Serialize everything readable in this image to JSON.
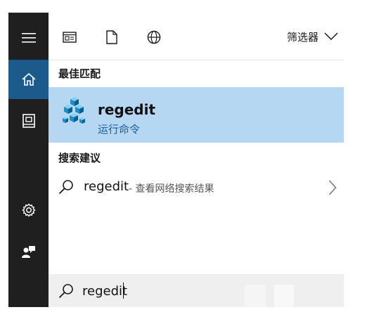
{
  "filter_bar": {
    "icons": [
      "apps-icon",
      "documents-icon",
      "web-icon"
    ],
    "filter_label": "筛选器"
  },
  "left_rail": {
    "items": [
      "menu-icon",
      "home-icon",
      "notebook-icon",
      "settings-icon",
      "feedback-icon"
    ],
    "active": "home-icon",
    "accent_color": "#1b5a8a"
  },
  "best_match": {
    "header": "最佳匹配",
    "title": "regedit",
    "subtitle": "运行命令",
    "highlight_color": "#b5d7f2",
    "icon": "registry-editor-icon"
  },
  "suggestions": {
    "header": "搜索建议",
    "items": [
      {
        "query": "regedit",
        "description": "- 查看网络搜索结果"
      }
    ]
  },
  "search": {
    "value": "regedit"
  }
}
